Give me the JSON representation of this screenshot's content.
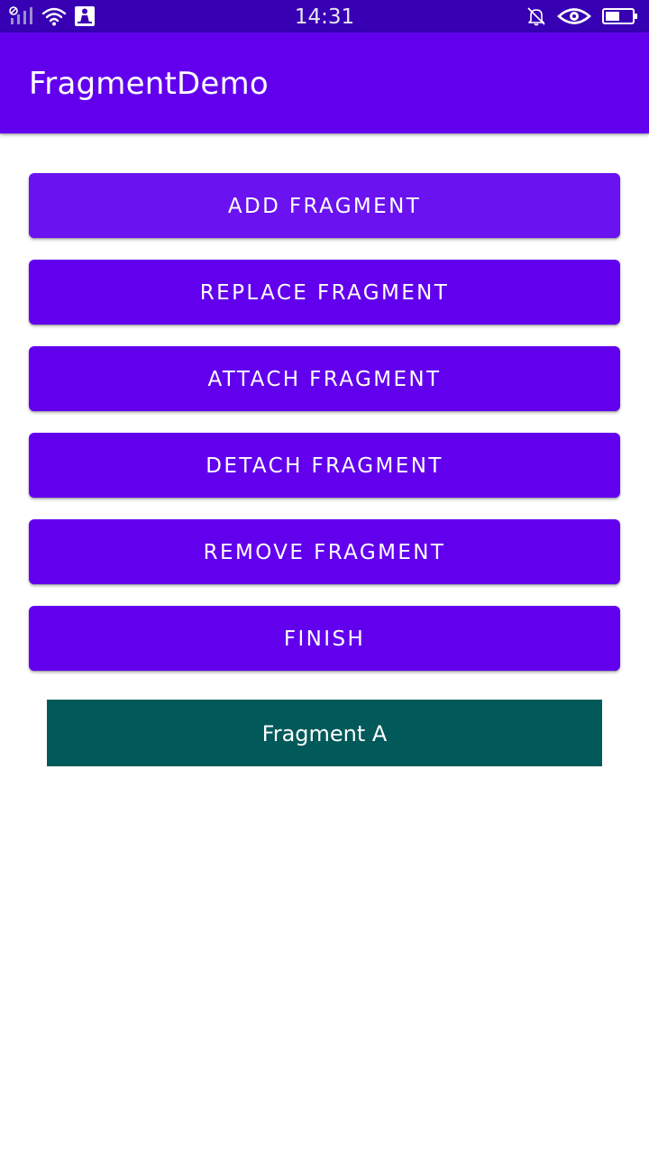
{
  "status_bar": {
    "time": "14:31",
    "icons": [
      "signal-icon",
      "wifi-icon",
      "notification-app-icon",
      "silent-bell-icon",
      "eye-icon",
      "battery-icon"
    ],
    "background": "#3700b3"
  },
  "app_bar": {
    "title": "FragmentDemo",
    "color": "#6200ee"
  },
  "buttons": [
    "ADD FRAGMENT",
    "REPLACE FRAGMENT",
    "ATTACH FRAGMENT",
    "DETACH FRAGMENT",
    "REMOVE FRAGMENT",
    "FINISH"
  ],
  "fragment": {
    "label": "Fragment A",
    "color": "#01595a"
  }
}
